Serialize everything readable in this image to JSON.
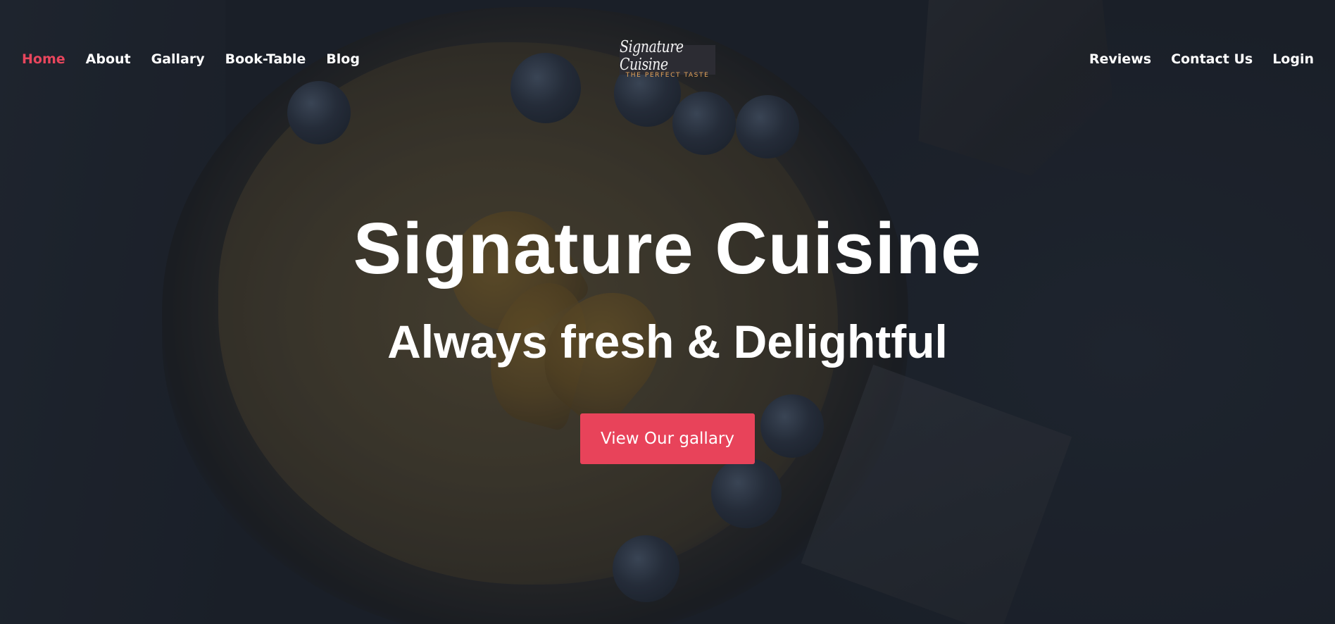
{
  "nav": {
    "left_items": [
      {
        "label": "Home",
        "active": true
      },
      {
        "label": "About",
        "active": false
      },
      {
        "label": "Gallary",
        "active": false
      },
      {
        "label": "Book-Table",
        "active": false
      },
      {
        "label": "Blog",
        "active": false
      }
    ],
    "right_items": [
      {
        "label": "Reviews"
      },
      {
        "label": "Contact Us"
      },
      {
        "label": "Login"
      }
    ]
  },
  "logo": {
    "title": "Signature Cuisine",
    "tagline": "THE PERFECT TASTE"
  },
  "hero": {
    "title": "Signature Cuisine",
    "subtitle": "Always fresh & Delightful",
    "cta_label": "View Our gallary"
  },
  "colors": {
    "accent": "#e8435a",
    "active_nav": "#e8465d",
    "logo_tagline": "#e3a35a"
  }
}
